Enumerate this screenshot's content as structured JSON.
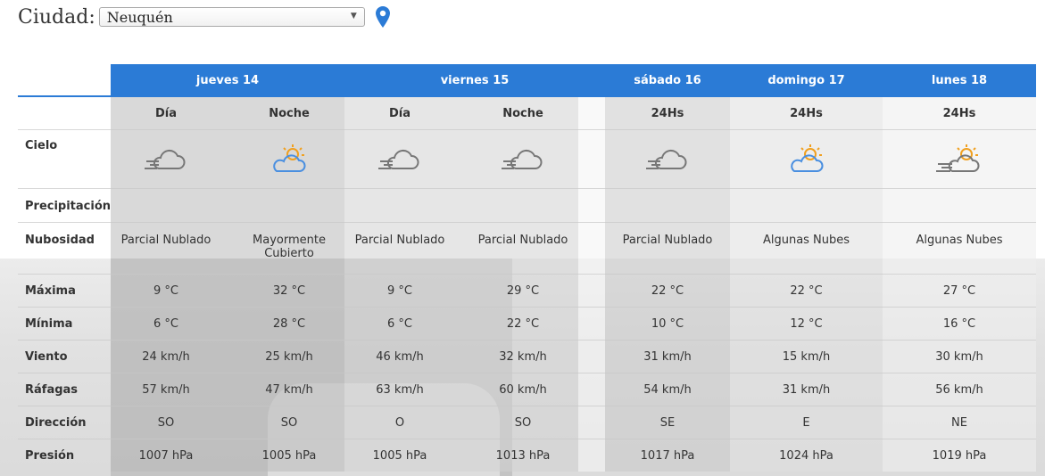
{
  "header": {
    "city_label": "Ciudad:",
    "city_value": "Neuquén"
  },
  "days": [
    {
      "label": "jueves 14"
    },
    {
      "label": "viernes 15"
    },
    {
      "label": "sábado 16"
    },
    {
      "label": "domingo 17"
    },
    {
      "label": "lunes 18"
    }
  ],
  "row_labels": {
    "cielo": "Cielo",
    "precipitacion": "Precipitación",
    "nubosidad": "Nubosidad",
    "maxima": "Máxima",
    "minima": "Mínima",
    "viento": "Viento",
    "rafagas": "Ráfagas",
    "direccion": "Dirección",
    "presion": "Presión"
  },
  "columns": [
    {
      "period": "Día",
      "icon": "windy-cloud-icon",
      "nubosidad": "Parcial Nublado",
      "maxima": "9 °C",
      "minima": "6 °C",
      "viento": "24 km/h",
      "rafagas": "57 km/h",
      "direccion": "SO",
      "presion": "1007 hPa"
    },
    {
      "period": "Noche",
      "icon": "sun-cloud-blue-icon",
      "nubosidad": "Mayormente Cubierto",
      "maxima": "32 °C",
      "minima": "28 °C",
      "viento": "25 km/h",
      "rafagas": "47 km/h",
      "direccion": "SO",
      "presion": "1005 hPa"
    },
    {
      "period": "Día",
      "icon": "windy-cloud-icon",
      "nubosidad": "Parcial Nublado",
      "maxima": "9 °C",
      "minima": "6 °C",
      "viento": "46 km/h",
      "rafagas": "63 km/h",
      "direccion": "O",
      "presion": "1005 hPa"
    },
    {
      "period": "Noche",
      "icon": "windy-cloud-icon",
      "nubosidad": "Parcial Nublado",
      "maxima": "29 °C",
      "minima": "22 °C",
      "viento": "32 km/h",
      "rafagas": "60 km/h",
      "direccion": "SO",
      "presion": "1013 hPa"
    },
    {
      "period": "24Hs",
      "icon": "windy-cloud-icon",
      "nubosidad": "Parcial Nublado",
      "maxima": "22 °C",
      "minima": "10 °C",
      "viento": "31 km/h",
      "rafagas": "54 km/h",
      "direccion": "SE",
      "presion": "1017 hPa"
    },
    {
      "period": "24Hs",
      "icon": "sun-cloud-blue-icon",
      "nubosidad": "Algunas Nubes",
      "maxima": "22 °C",
      "minima": "12 °C",
      "viento": "15 km/h",
      "rafagas": "31 km/h",
      "direccion": "E",
      "presion": "1024 hPa"
    },
    {
      "period": "24Hs",
      "icon": "sun-cloud-grey-icon",
      "nubosidad": "Algunas Nubes",
      "maxima": "27 °C",
      "minima": "16 °C",
      "viento": "30 km/h",
      "rafagas": "56 km/h",
      "direccion": "NE",
      "presion": "1019 hPa"
    }
  ],
  "colors": {
    "accent": "#2b7bd6",
    "header_text": "#ffffff",
    "sun": "#f0a020",
    "cloud_grey": "#777777",
    "cloud_blue": "#4a8fe0"
  }
}
